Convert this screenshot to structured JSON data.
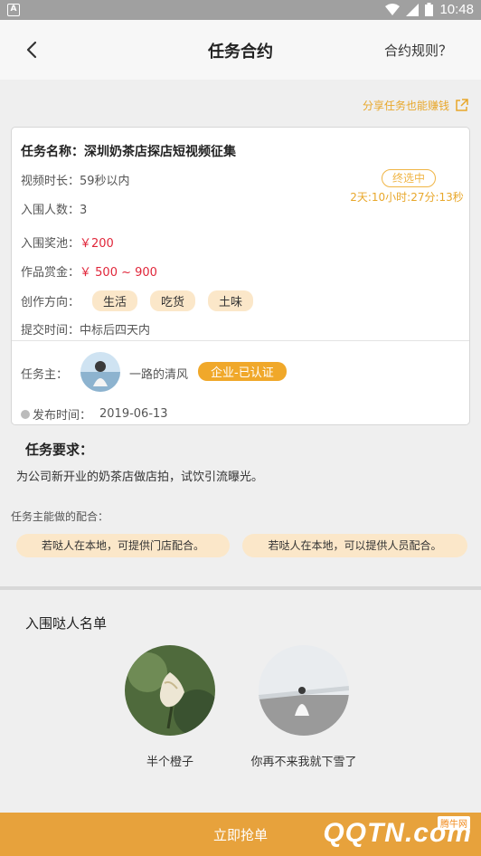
{
  "status_bar": {
    "time": "10:48",
    "app_badge": "A"
  },
  "nav": {
    "title": "任务合约",
    "rules_label": "合约规则？"
  },
  "share_label": "分享任务也能赚钱",
  "task": {
    "name": "任务名称：深圳奶茶店探店短视频征集",
    "duration": "视频时长：59秒以内",
    "shortlist_count": "入围人数：3",
    "prize_label": "入围奖池：",
    "prize_value": "￥200",
    "reward_label": "作品赏金：",
    "reward_value": "￥ 500 ~ 900",
    "direction_label": "创作方向：",
    "tags": [
      "生活",
      "吃货",
      "土味"
    ],
    "submit_time": "提交时间：中标后四天内",
    "status": "终选中",
    "countdown": "2天:10小时:27分:13秒"
  },
  "owner": {
    "label": "任务主：",
    "name": "一路的清风",
    "badge": "企业-已认证",
    "publish_label": "发布时间：",
    "publish_date": "2019-06-13"
  },
  "requirements": {
    "title": "任务要求：",
    "description": "为公司新开业的奶茶店做店拍，试饮引流曝光。",
    "cooperation_title": "任务主能做的配合：",
    "cooperation": [
      "若哒人在本地，可提供门店配合。",
      "若哒人在本地，可以提供人员配合。"
    ]
  },
  "shortlist": {
    "title": "入围哒人名单",
    "people": [
      {
        "name": "半个橙子"
      },
      {
        "name": "你再不来我就下雪了"
      }
    ]
  },
  "bottom": {
    "grab_label": "立即抢单",
    "watermark": "QQTN.com",
    "watermark_tag": "腾牛网"
  },
  "colors": {
    "accent": "#e8a72a",
    "money": "#e0263a",
    "tag_bg": "#fbe7c9",
    "bottom_bar": "#e7a23c"
  }
}
